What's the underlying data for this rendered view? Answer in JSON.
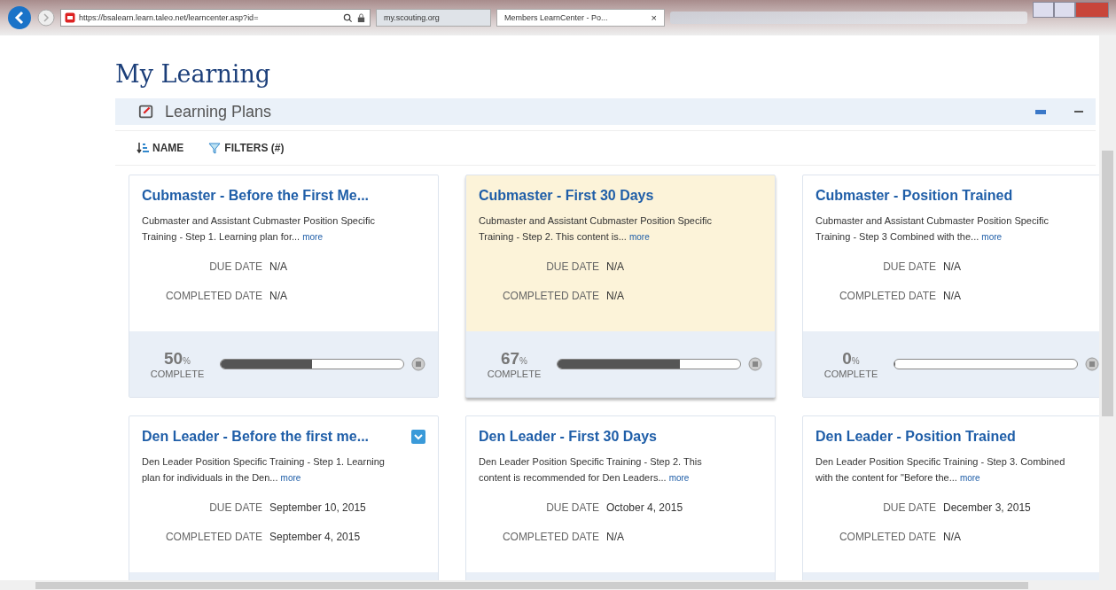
{
  "browser": {
    "url": "https://bsalearn.learn.taleo.net/learncenter.asp?id=",
    "tabs": [
      {
        "label": "my.scouting.org",
        "selected": false
      },
      {
        "label": "Members LearnCenter - Po...",
        "selected": true,
        "close": "×"
      }
    ]
  },
  "page": {
    "title": "My Learning",
    "section": "Learning Plans"
  },
  "toolbar": {
    "sort": "NAME",
    "filters": "FILTERS (#)"
  },
  "cards": [
    {
      "title": "Cubmaster - Before the First Me...",
      "description": "Cubmaster and Assistant Cubmaster Position Specific Training - Step 1. Learning plan for...",
      "more": "more",
      "due_label": "DUE DATE",
      "due": "N/A",
      "completed_label": "COMPLETED DATE",
      "completed": "N/A",
      "selected": false,
      "checked": false,
      "percent": "50",
      "percent_sign": "%",
      "complete_label": "COMPLETE",
      "level": 0.5
    },
    {
      "title": "Cubmaster - First 30 Days",
      "description": "Cubmaster and Assistant Cubmaster Position Specific Training - Step 2. This content is...",
      "more": "more",
      "due_label": "DUE DATE",
      "due": "N/A",
      "completed_label": "COMPLETED DATE",
      "completed": "N/A",
      "selected": true,
      "checked": false,
      "percent": "67",
      "percent_sign": "%",
      "complete_label": "COMPLETE",
      "level": 0.67
    },
    {
      "title": "Cubmaster - Position Trained",
      "description": "Cubmaster and Assistant Cubmaster Position Specific Training - Step 3 Combined with the...",
      "more": "more",
      "due_label": "DUE DATE",
      "due": "N/A",
      "completed_label": "COMPLETED DATE",
      "completed": "N/A",
      "selected": false,
      "checked": false,
      "percent": "0",
      "percent_sign": "%",
      "complete_label": "COMPLETE",
      "level": 0
    },
    {
      "title": "Den Leader - Before the first me...",
      "description": "Den Leader Position Specific Training - Step 1. Learning plan for individuals in the Den...",
      "more": "more",
      "due_label": "DUE DATE",
      "due": "September 10, 2015",
      "completed_label": "COMPLETED DATE",
      "completed": "September 4, 2015",
      "selected": false,
      "checked": true
    },
    {
      "title": "Den Leader - First 30 Days",
      "description": "Den Leader Position Specific Training - Step 2. This content is recommended for Den Leaders...",
      "more": "more",
      "due_label": "DUE DATE",
      "due": "October 4, 2015",
      "completed_label": "COMPLETED DATE",
      "completed": "N/A",
      "selected": false,
      "checked": false
    },
    {
      "title": "Den Leader - Position Trained",
      "description": "Den Leader Position Specific Training - Step 3. Combined with the content for \"Before the...",
      "more": "more",
      "due_label": "DUE DATE",
      "due": "December 3, 2015",
      "completed_label": "COMPLETED DATE",
      "completed": "N/A",
      "selected": false,
      "checked": false
    }
  ]
}
